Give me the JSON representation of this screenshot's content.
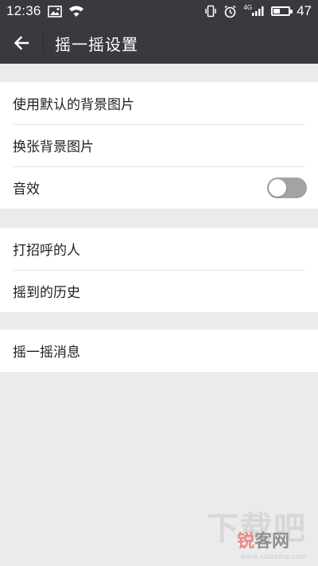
{
  "status_bar": {
    "time": "12:36",
    "network_label": "4G",
    "battery_level": "47",
    "battery_fraction": 0.47
  },
  "app_bar": {
    "title": "摇一摇设置"
  },
  "groups": [
    {
      "items": [
        {
          "label": "使用默认的背景图片"
        },
        {
          "label": "换张背景图片"
        },
        {
          "label": "音效",
          "toggle": false
        }
      ]
    },
    {
      "items": [
        {
          "label": "打招呼的人"
        },
        {
          "label": "摇到的历史"
        }
      ]
    },
    {
      "items": [
        {
          "label": "摇一摇消息"
        }
      ]
    }
  ],
  "watermark": {
    "text_big": "下载吧",
    "text_cn_a": "锐",
    "text_cn_b": "客网",
    "url": "www.xiazaiba.com"
  },
  "colors": {
    "header_bg": "#393a3f",
    "page_bg": "#ebebeb",
    "toggle_off": "#a3a3a3"
  }
}
